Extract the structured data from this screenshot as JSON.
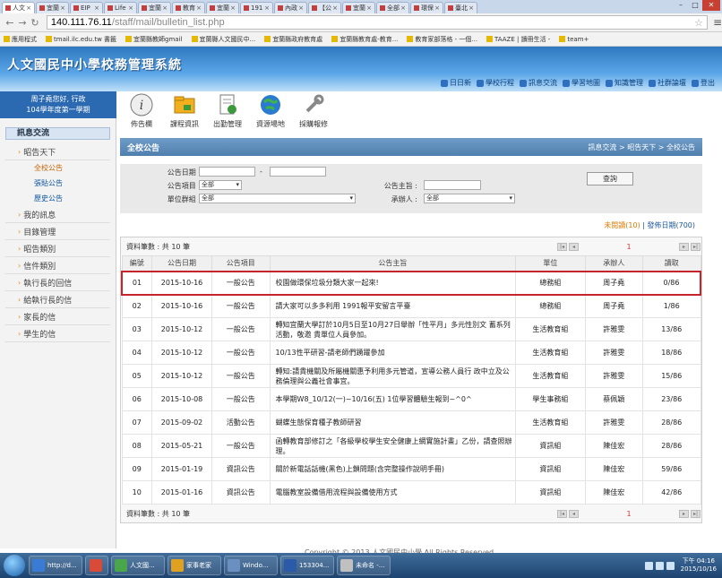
{
  "browser": {
    "tabs": [
      {
        "label": "人文",
        "active": true
      },
      {
        "label": "宜蘭"
      },
      {
        "label": "EIP"
      },
      {
        "label": "Life"
      },
      {
        "label": "宜蘭"
      },
      {
        "label": "教育"
      },
      {
        "label": "宜蘭"
      },
      {
        "label": "191"
      },
      {
        "label": "內政"
      },
      {
        "label": "【公"
      },
      {
        "label": "宜蘭"
      },
      {
        "label": "全部"
      },
      {
        "label": "環保"
      },
      {
        "label": "臺北"
      }
    ],
    "url_host": "140.111.76.11",
    "url_path": "/staff/mail/bulletin_list.php",
    "bookmarks": [
      "應用程式",
      "tmail.ilc.edu.tw 書籤",
      "宜蘭縣教師gmail",
      "宜蘭縣人文國民中...",
      "宜蘭縣政府教育處",
      "宜蘭縣教育處-教育...",
      "教育家部落格 - 一個...",
      "TAAZE | 讀冊生活 -",
      "team+"
    ]
  },
  "site": {
    "title": "人文國民中小學校務管理系統",
    "header_links": [
      "日日新",
      "學校行程",
      "訊息交流",
      "學習地圖",
      "知識管理",
      "社群論壇",
      "登出"
    ],
    "user_line1": "周子堯您好, 行政",
    "user_line2": "104學年度第一學期"
  },
  "sidebar": {
    "heading": "訊息交流",
    "items": [
      {
        "label": "昭告天下",
        "subs": [
          "全校公告",
          "張貼公告",
          "歷史公告"
        ]
      },
      {
        "label": "我的訊息"
      },
      {
        "label": "目錄管理"
      },
      {
        "label": "昭告類別"
      },
      {
        "label": "信件類別"
      },
      {
        "label": "執行長的回信"
      },
      {
        "label": "給執行長的信"
      },
      {
        "label": "家長的信"
      },
      {
        "label": "學生的信"
      }
    ]
  },
  "toolbar": [
    "佈告欄",
    "課程資訊",
    "出勤管理",
    "資源場地",
    "採購報修"
  ],
  "main": {
    "section_title": "全校公告",
    "breadcrumb": "訊息交流 > 昭告天下 > 全校公告",
    "search": {
      "date_label": "公告日期 :",
      "date_sep": "-",
      "category_label": "公告項目 :",
      "category_value": "全部",
      "group_label": "單位群組 :",
      "group_value": "全部",
      "subject_label": "公告主旨 :",
      "handler_label": "承辦人 :",
      "handler_value": "全部",
      "query_button": "查詢"
    },
    "counts_unread": "未閱讀(10)",
    "counts_sep": " | ",
    "counts_published": "發佈日期(700)",
    "record_count": "資料筆數 : 共 10 筆",
    "page": "1",
    "columns": [
      "編號",
      "公告日期",
      "公告項目",
      "公告主旨",
      "單位",
      "承辦人",
      "讀取"
    ],
    "rows": [
      {
        "no": "01",
        "date": "2015-10-16",
        "cat": "一般公告",
        "subject": "校園做環保垃圾分類大家一起來!",
        "unit": "總務組",
        "handler": "周子堯",
        "read": "0/86"
      },
      {
        "no": "02",
        "date": "2015-10-16",
        "cat": "一般公告",
        "subject": "請大家可以多多利用 1991報平安留言平臺",
        "unit": "總務組",
        "handler": "周子堯",
        "read": "1/86"
      },
      {
        "no": "03",
        "date": "2015-10-12",
        "cat": "一般公告",
        "subject": "轉知宜蘭大學訂於10月5日至10月27日舉辦「性平月」多元性別文 蓄系列活動，敬邀 貴單位人員參加。",
        "unit": "生活教育組",
        "handler": "許雅雯",
        "read": "13/86"
      },
      {
        "no": "04",
        "date": "2015-10-12",
        "cat": "一般公告",
        "subject": "10/13性平研習-請老師們踴躍參加",
        "unit": "生活教育組",
        "handler": "許雅雯",
        "read": "18/86"
      },
      {
        "no": "05",
        "date": "2015-10-12",
        "cat": "一般公告",
        "subject": "轉知:請貴機關及所屬機關惠予利用多元管道，宣導公務人員行 政中立及公務倫理與公義社會事宜。",
        "unit": "生活教育組",
        "handler": "許雅雯",
        "read": "15/86"
      },
      {
        "no": "06",
        "date": "2015-10-08",
        "cat": "一般公告",
        "subject": "本學期W8_10/12(一)~10/16(五) 1位學習體驗生報到~^0^",
        "unit": "學生事務組",
        "handler": "蔡佩穎",
        "read": "23/86"
      },
      {
        "no": "07",
        "date": "2015-09-02",
        "cat": "活動公告",
        "subject": "蝴蝶生態保育種子教師研習",
        "unit": "生活教育組",
        "handler": "許雅雯",
        "read": "28/86"
      },
      {
        "no": "08",
        "date": "2015-05-21",
        "cat": "一般公告",
        "subject": "函轉教育部修訂之「各級學校學生安全健康上網實施計畫」乙份，請查照辦理。",
        "unit": "資訊組",
        "handler": "陳佳宏",
        "read": "28/86"
      },
      {
        "no": "09",
        "date": "2015-01-19",
        "cat": "資訊公告",
        "subject": "關於新電話話機(黑色)上鎖問題(含完整操作說明手冊)",
        "unit": "資訊組",
        "handler": "陳佳宏",
        "read": "59/86"
      },
      {
        "no": "10",
        "date": "2015-01-16",
        "cat": "資訊公告",
        "subject": "電腦教室設備借用流程與設備使用方式",
        "unit": "資訊組",
        "handler": "陳佳宏",
        "read": "42/86"
      }
    ],
    "copyright": "Copyright © 2013 人文國民中小學 All Rights Reserved"
  },
  "taskbar": {
    "tasks": [
      "http://d...",
      "",
      "人文國...",
      "家事老家",
      "Windo...",
      "153304...",
      "未命名 -..."
    ],
    "time": "下午 04:16",
    "date": "2015/10/16"
  },
  "colors": {
    "highlight": "#c4242a",
    "header": "#2f78c0",
    "sidebar_user": "#2b6ab0",
    "section_bar": "#4f7fae"
  }
}
